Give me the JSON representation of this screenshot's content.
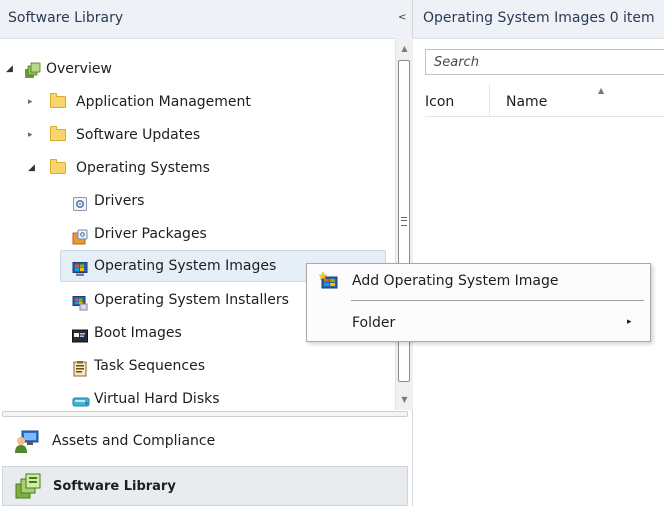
{
  "left_pane": {
    "title": "Software Library",
    "collapse_glyph": "<",
    "tree": {
      "overview": {
        "label": "Overview",
        "expander": "◢",
        "icon": "overview-icon"
      },
      "application_management": {
        "label": "Application Management",
        "expander": "▸",
        "icon": "folder-icon"
      },
      "software_updates": {
        "label": "Software Updates",
        "expander": "▸",
        "icon": "folder-icon"
      },
      "operating_systems": {
        "label": "Operating Systems",
        "expander": "◢",
        "icon": "folder-icon"
      },
      "drivers": {
        "label": "Drivers",
        "icon": "driver-icon"
      },
      "driver_packages": {
        "label": "Driver Packages",
        "icon": "driver-package-icon"
      },
      "operating_system_images": {
        "label": "Operating System Images",
        "icon": "os-image-icon",
        "selected": true
      },
      "operating_system_installers": {
        "label": "Operating System Installers",
        "icon": "os-installer-icon"
      },
      "boot_images": {
        "label": "Boot Images",
        "icon": "boot-image-icon"
      },
      "task_sequences": {
        "label": "Task Sequences",
        "icon": "task-sequence-icon"
      },
      "virtual_hard_disks": {
        "label": "Virtual Hard Disks",
        "icon": "virtual-disk-icon"
      }
    },
    "workspaces": [
      {
        "label": "Assets and Compliance",
        "icon": "assets-icon",
        "active": false
      },
      {
        "label": "Software Library",
        "icon": "software-library-icon",
        "active": true
      }
    ]
  },
  "right_pane": {
    "title": "Operating System Images 0 item",
    "search_placeholder": "Search",
    "columns": {
      "icon": "Icon",
      "name": "Name"
    }
  },
  "context_menu": {
    "items": [
      {
        "label": "Add Operating System Image",
        "icon": "add-os-image-icon"
      },
      {
        "label": "Folder",
        "submenu_glyph": "▸"
      }
    ]
  },
  "colors": {
    "header_bg": "#eef1f6",
    "selected_bg": "#e6eef7",
    "folder": "#f7d56a"
  }
}
